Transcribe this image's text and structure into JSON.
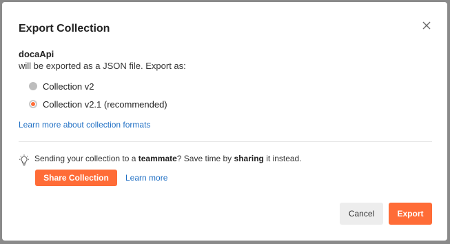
{
  "dialog": {
    "title": "Export Collection",
    "collection_name": "docaApi",
    "description": "will be exported as a JSON file. Export as:",
    "options": [
      {
        "label": "Collection v2",
        "selected": false
      },
      {
        "label": "Collection v2.1 (recommended)",
        "selected": true
      }
    ],
    "learn_formats_link": "Learn more about collection formats",
    "tip": {
      "part1": "Sending your collection to a ",
      "bold1": "teammate",
      "part2": "? Save time by ",
      "bold2": "sharing",
      "part3": " it instead."
    },
    "share_button": "Share Collection",
    "learn_more_link": "Learn more",
    "cancel_button": "Cancel",
    "export_button": "Export"
  },
  "colors": {
    "accent": "#ff6c37",
    "link": "#1f6fc4",
    "backdrop": "#8a8a8a"
  },
  "icons": [
    "close-icon",
    "lightbulb-icon",
    "radio-unselected-icon",
    "radio-selected-icon"
  ]
}
